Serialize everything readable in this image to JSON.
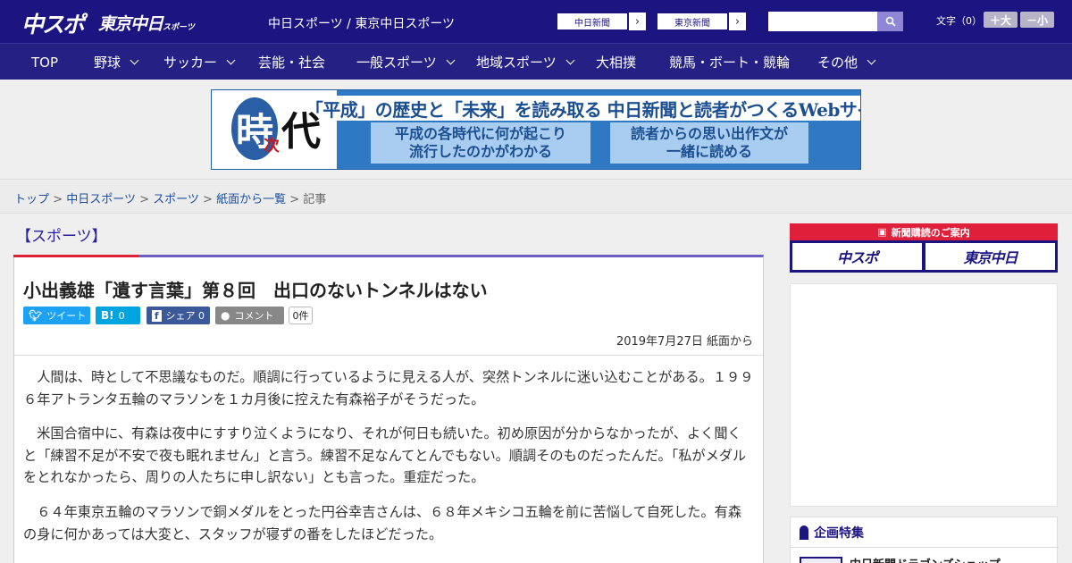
{
  "header": {
    "logo_chuspo": "中スポ",
    "logo_tokyo": "東京中日",
    "logo_tokyo_small": "スポーツ",
    "site_names": "中日スポーツ / 東京中日スポーツ",
    "btn_chunichi": "中日新聞",
    "btn_tokyo": "東京新聞",
    "search_placeholder": "",
    "font_label": "文字（0）",
    "font_plus": "＋大",
    "font_minus": "－小"
  },
  "nav": {
    "items": [
      {
        "label": "TOP",
        "dropdown": false
      },
      {
        "label": "野球",
        "dropdown": true
      },
      {
        "label": "サッカー",
        "dropdown": true
      },
      {
        "label": "芸能・社会",
        "dropdown": false
      },
      {
        "label": "一般スポーツ",
        "dropdown": true
      },
      {
        "label": "地域スポーツ",
        "dropdown": true
      },
      {
        "label": "大相撲",
        "dropdown": false
      },
      {
        "label": "競馬・ボート・競輪",
        "dropdown": false
      },
      {
        "label": "その他",
        "dropdown": true
      }
    ]
  },
  "banner": {
    "ji_a": "時",
    "ji_b": "代",
    "ji_c": "次",
    "title": "「平成」の歴史と「未来」を読み取る 中日新聞と読者がつくるWebサイト",
    "box1_line1": "平成の各時代に何が起こり",
    "box1_line2": "流行したのかがわかる",
    "box2_line1": "読者からの思い出作文が",
    "box2_line2": "一緒に読める"
  },
  "breadcrumb": {
    "items": [
      "トップ",
      "中日スポーツ",
      "スポーツ",
      "紙面から一覧"
    ],
    "current": "記事",
    "separator": ">"
  },
  "article": {
    "category": "【スポーツ】",
    "headline": "小出義雄「遺す言葉」第８回　出口のないトンネルはない",
    "share": {
      "tweet": "ツイート",
      "hatena": "0",
      "hatena_icon": "B!",
      "facebook": "シェア",
      "facebook_count": "0",
      "comment": "コメント",
      "comment_count": "0件"
    },
    "date": "2019年7月27日 紙面から",
    "paragraphs": [
      "　人間は、時として不思議なものだ。順調に行っているように見える人が、突然トンネルに迷い込むことがある。１９９６年アトランタ五輪のマラソンを１カ月後に控えた有森裕子がそうだった。",
      "　米国合宿中に、有森は夜中にすすり泣くようになり、それが何日も続いた。初め原因が分からなかったが、よく聞くと「練習不足が不安で夜も眠れません」と言う。練習不足なんてとんでもない。順調そのものだったんだ。「私がメダルをとれなかったら、周りの人たちに申し訳ない」とも言った。重症だった。",
      "　６４年東京五輪のマラソンで銅メダルをとった円谷幸吉さんは、６８年メキシコ五輪を前に苦悩して自死した。有森の身に何かあっては大変と、スタッフが寝ずの番をしたほどだった。"
    ]
  },
  "sidebar": {
    "subscribe_label": "新聞購読のご案内",
    "sub_btn1": "中スポ",
    "sub_btn2": "東京中日",
    "feature_title": "企画特集",
    "feature_item": "中日新聞ドラゴンズショップ"
  },
  "colors": {
    "header_bg": "#1c1480",
    "nav_bg": "#252084",
    "accent_red": "#e0203a",
    "twitter": "#1da1f2",
    "hatena": "#00a4de",
    "facebook": "#3b5998",
    "comment": "#888888"
  }
}
